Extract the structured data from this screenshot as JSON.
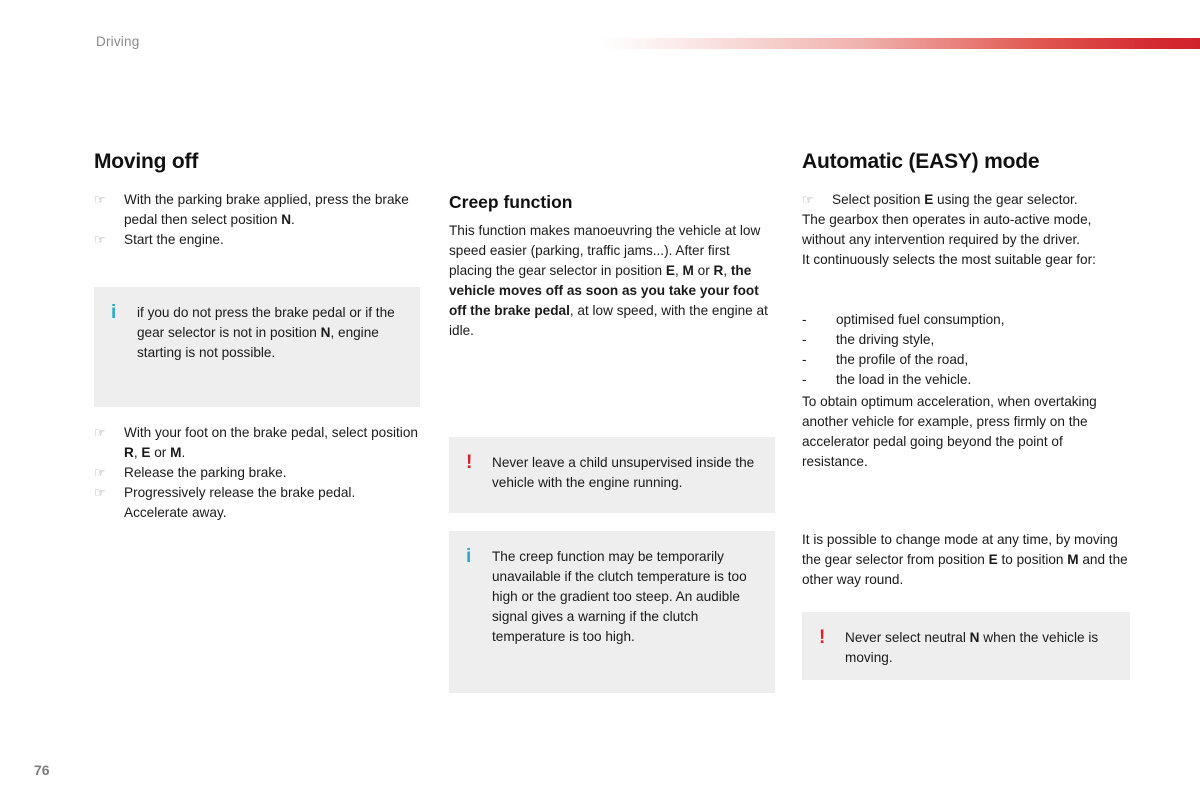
{
  "header": {
    "chapter": "Driving",
    "rule_color": "#d42a32"
  },
  "footer": {
    "page_number": "76"
  },
  "icons": {
    "hand_bullet": "☞",
    "info": "i",
    "warning": "!",
    "dash": "-"
  },
  "column_1": {
    "title": "Moving off",
    "steps_top": [
      "With the parking brake applied, press the brake pedal then select position <b>N</b>.",
      "Start the engine."
    ],
    "info_box": "if you do not press the brake pedal or if the gear selector is not in position <b>N</b>, engine starting is not possible.",
    "steps_bottom": [
      "With your foot on the brake pedal, select position <b>R</b>, <b>E</b> or <b>M</b>.",
      "Release the parking brake.",
      "Progressively release the brake pedal. Accelerate away."
    ]
  },
  "column_2": {
    "title": "Creep function",
    "paragraph": "This function makes manoeuvring the vehicle at low speed easier (parking, traffic jams...). After first placing the gear selector in position <b>E</b>, <b>M</b> or <b>R</b>, <b>the vehicle moves off as soon as you take your foot off the brake pedal</b>, at low speed, with the engine at idle.",
    "warning_box": "Never leave a child unsupervised inside the vehicle with the engine running.",
    "info_box": "The creep function may be temporarily unavailable if the clutch temperature is too high or the gradient too steep. An audible signal gives a warning if the clutch temperature is too high."
  },
  "column_3": {
    "title": "Automatic (EASY) mode",
    "step": "Select position <b>E</b> using the gear selector.",
    "paragraph_1": "The gearbox then operates in auto-active mode, without any intervention required by the driver.<br>It continuously selects the most suitable gear for:",
    "bullets": [
      "optimised fuel consumption,",
      "the driving style,",
      "the profile of the road,",
      "the load in the vehicle."
    ],
    "paragraph_2": "To obtain optimum acceleration, when overtaking another vehicle for example, press firmly on the accelerator pedal going beyond the point of resistance.",
    "paragraph_3": "It is possible to change mode at any time, by moving the gear selector from position <b>E</b> to position <b>M</b> and the other way round.",
    "warning_box": "Never select neutral <b>N</b> when the vehicle is moving."
  }
}
